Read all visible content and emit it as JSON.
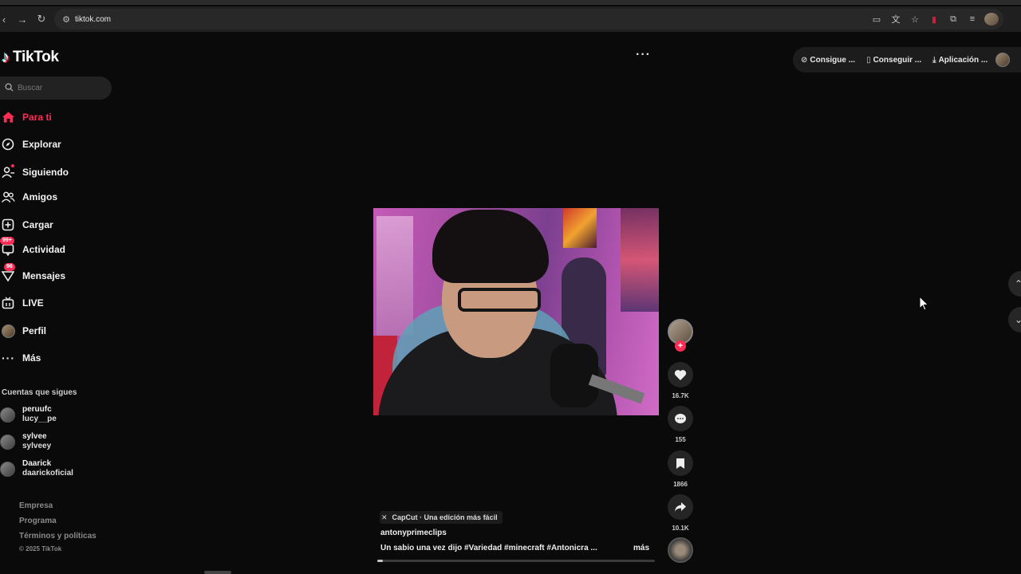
{
  "browser": {
    "url": "tiktok.com"
  },
  "app": {
    "logo_text": "TikTok",
    "search_placeholder": "Buscar"
  },
  "sidebar": {
    "items": [
      {
        "label": "Para ti",
        "icon": "home-icon",
        "active": true
      },
      {
        "label": "Explorar",
        "icon": "compass-icon"
      },
      {
        "label": "Siguiendo",
        "icon": "user-follow-icon"
      },
      {
        "label": "Amigos",
        "icon": "friends-icon"
      },
      {
        "label": "Cargar",
        "icon": "upload-plus-icon"
      },
      {
        "label": "Actividad",
        "icon": "activity-icon",
        "badge": "99+"
      },
      {
        "label": "Mensajes",
        "icon": "messages-icon",
        "badge": "96"
      },
      {
        "label": "LIVE",
        "icon": "live-icon"
      },
      {
        "label": "Perfil",
        "icon": "profile-avatar"
      },
      {
        "label": "Más",
        "icon": "more-icon"
      }
    ],
    "following_heading": "Cuentas que sigues",
    "following": [
      {
        "name": "peruufc",
        "handle": "lucy__pe"
      },
      {
        "name": "sylvee",
        "handle": "sylveey"
      },
      {
        "name": "Daarick",
        "handle": "daarickoficial"
      }
    ],
    "footer": {
      "links": [
        "Empresa",
        "Programa",
        "Términos y políticas"
      ],
      "copyright": "© 2025 TikTok"
    }
  },
  "topbar": {
    "more": "···",
    "buttons": [
      {
        "label": "Consigue ...",
        "icon": "coin-icon"
      },
      {
        "label": "Conseguir ...",
        "icon": "phone-icon"
      },
      {
        "label": "Aplicación ...",
        "icon": "download-icon"
      }
    ]
  },
  "video": {
    "capcut_label": "CapCut · Una edición más fácil",
    "author": "antonyprimeclips",
    "description": "Un sabio una vez dijo #Variedad  #minecraft  #Antonicra  ...",
    "more_label": "más",
    "progress_fraction": 0.02,
    "likes": "16.7K",
    "comments": "155",
    "saves": "1866",
    "shares": "10.1K",
    "follow_plus": "+"
  },
  "colors": {
    "accent": "#fe2c55",
    "background": "#0a0a0a"
  }
}
